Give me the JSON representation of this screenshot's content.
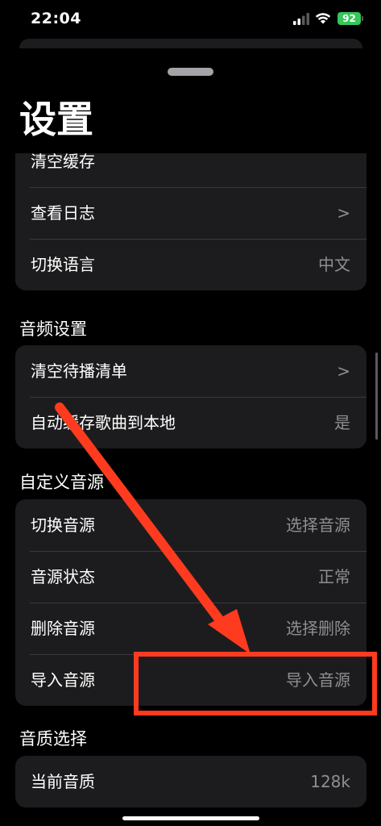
{
  "status_bar": {
    "time": "22:04",
    "battery": "92"
  },
  "title": "设置",
  "sections": {
    "general": {
      "rows": [
        {
          "label": "清空缓存",
          "value": ""
        },
        {
          "label": "查看日志",
          "value": ">"
        },
        {
          "label": "切换语言",
          "value": "中文"
        }
      ]
    },
    "audio": {
      "header": "音频设置",
      "rows": [
        {
          "label": "清空待播清单",
          "value": ">"
        },
        {
          "label": "自动缓存歌曲到本地",
          "value": "是"
        }
      ]
    },
    "custom_source": {
      "header": "自定义音源",
      "rows": [
        {
          "label": "切换音源",
          "value": "选择音源"
        },
        {
          "label": "音源状态",
          "value": "正常"
        },
        {
          "label": "删除音源",
          "value": "选择删除"
        },
        {
          "label": "导入音源",
          "value": "导入音源"
        }
      ]
    },
    "quality": {
      "header": "音质选择",
      "rows": [
        {
          "label": "当前音质",
          "value": "128k"
        }
      ]
    }
  },
  "colors": {
    "background": "#000000",
    "card": "#1c1c1e",
    "secondary_text": "#8e8e93",
    "annotation": "#ff3b1f",
    "battery": "#34c759"
  },
  "icons": [
    "signal-icon",
    "wifi-icon",
    "battery-icon"
  ]
}
